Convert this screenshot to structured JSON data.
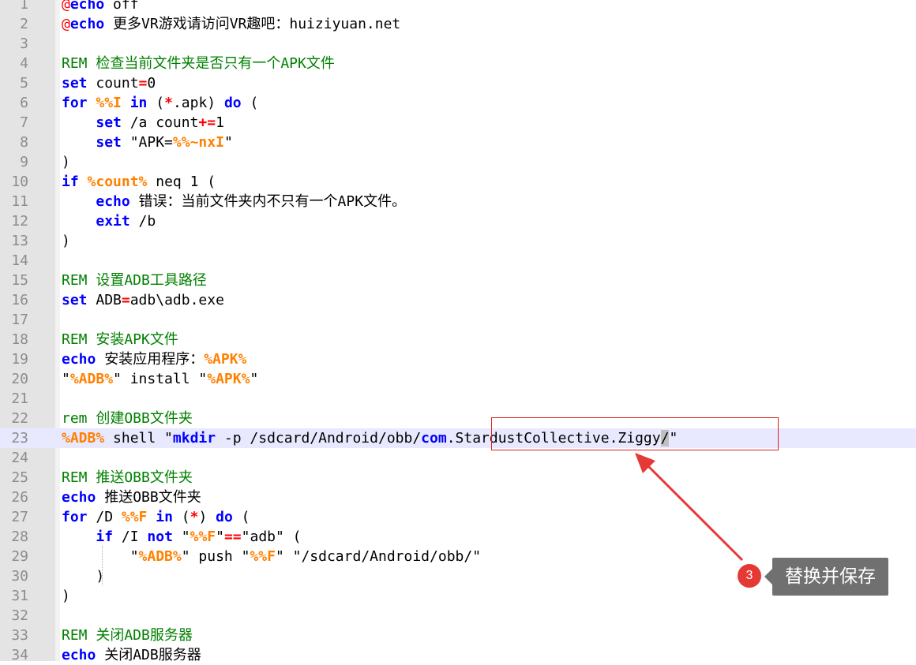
{
  "editor": {
    "lines": [
      {
        "num": "1",
        "tokens": [
          {
            "t": "at",
            "v": "@"
          },
          {
            "t": "kw",
            "v": "echo"
          },
          {
            "t": "tx",
            "v": " off"
          }
        ]
      },
      {
        "num": "2",
        "tokens": [
          {
            "t": "at",
            "v": "@"
          },
          {
            "t": "kw",
            "v": "echo"
          },
          {
            "t": "tx",
            "v": " 更多VR游戏请访问VR趣吧：huiziyuan.net"
          }
        ]
      },
      {
        "num": "3",
        "tokens": []
      },
      {
        "num": "4",
        "tokens": [
          {
            "t": "cm",
            "v": "REM 检查当前文件夹是否只有一个APK文件"
          }
        ]
      },
      {
        "num": "5",
        "tokens": [
          {
            "t": "kw",
            "v": "set"
          },
          {
            "t": "tx",
            "v": " count"
          },
          {
            "t": "op",
            "v": "="
          },
          {
            "t": "tx",
            "v": "0"
          }
        ]
      },
      {
        "num": "6",
        "tokens": [
          {
            "t": "kw",
            "v": "for"
          },
          {
            "t": "tx",
            "v": " "
          },
          {
            "t": "var",
            "v": "%%I"
          },
          {
            "t": "tx",
            "v": " "
          },
          {
            "t": "kw",
            "v": "in"
          },
          {
            "t": "tx",
            "v": " ("
          },
          {
            "t": "op",
            "v": "*"
          },
          {
            "t": "tx",
            "v": ".apk) "
          },
          {
            "t": "kw",
            "v": "do"
          },
          {
            "t": "tx",
            "v": " ("
          }
        ]
      },
      {
        "num": "7",
        "tokens": [
          {
            "t": "tx",
            "v": "    "
          },
          {
            "t": "kw",
            "v": "set"
          },
          {
            "t": "tx",
            "v": " /a count"
          },
          {
            "t": "op",
            "v": "+="
          },
          {
            "t": "tx",
            "v": "1"
          }
        ]
      },
      {
        "num": "8",
        "tokens": [
          {
            "t": "tx",
            "v": "    "
          },
          {
            "t": "kw",
            "v": "set"
          },
          {
            "t": "tx",
            "v": " \"APK="
          },
          {
            "t": "var",
            "v": "%%~nxI"
          },
          {
            "t": "tx",
            "v": "\""
          }
        ]
      },
      {
        "num": "9",
        "tokens": [
          {
            "t": "tx",
            "v": ")"
          }
        ]
      },
      {
        "num": "10",
        "tokens": [
          {
            "t": "kw",
            "v": "if"
          },
          {
            "t": "tx",
            "v": " "
          },
          {
            "t": "var",
            "v": "%count%"
          },
          {
            "t": "tx",
            "v": " neq 1 ("
          }
        ]
      },
      {
        "num": "11",
        "tokens": [
          {
            "t": "tx",
            "v": "    "
          },
          {
            "t": "kw",
            "v": "echo"
          },
          {
            "t": "tx",
            "v": " 错误：当前文件夹内不只有一个APK文件。"
          }
        ]
      },
      {
        "num": "12",
        "tokens": [
          {
            "t": "tx",
            "v": "    "
          },
          {
            "t": "kw",
            "v": "exit"
          },
          {
            "t": "tx",
            "v": " /b"
          }
        ]
      },
      {
        "num": "13",
        "tokens": [
          {
            "t": "tx",
            "v": ")"
          }
        ]
      },
      {
        "num": "14",
        "tokens": []
      },
      {
        "num": "15",
        "tokens": [
          {
            "t": "cm",
            "v": "REM 设置ADB工具路径"
          }
        ]
      },
      {
        "num": "16",
        "tokens": [
          {
            "t": "kw",
            "v": "set"
          },
          {
            "t": "tx",
            "v": " ADB"
          },
          {
            "t": "op",
            "v": "="
          },
          {
            "t": "tx",
            "v": "adb\\adb.exe"
          }
        ]
      },
      {
        "num": "17",
        "tokens": []
      },
      {
        "num": "18",
        "tokens": [
          {
            "t": "cm",
            "v": "REM 安装APK文件"
          }
        ]
      },
      {
        "num": "19",
        "tokens": [
          {
            "t": "kw",
            "v": "echo"
          },
          {
            "t": "tx",
            "v": " 安装应用程序："
          },
          {
            "t": "var",
            "v": "%APK%"
          }
        ]
      },
      {
        "num": "20",
        "tokens": [
          {
            "t": "tx",
            "v": "\""
          },
          {
            "t": "var",
            "v": "%ADB%"
          },
          {
            "t": "tx",
            "v": "\" install \""
          },
          {
            "t": "var",
            "v": "%APK%"
          },
          {
            "t": "tx",
            "v": "\""
          }
        ]
      },
      {
        "num": "21",
        "tokens": []
      },
      {
        "num": "22",
        "tokens": [
          {
            "t": "cm",
            "v": "rem 创建OBB文件夹"
          }
        ]
      },
      {
        "num": "23",
        "current": true,
        "tokens": [
          {
            "t": "var",
            "v": "%ADB%"
          },
          {
            "t": "tx",
            "v": " shell \""
          },
          {
            "t": "kw",
            "v": "mkdir"
          },
          {
            "t": "tx",
            "v": " -p /sdcard/Android/obb/"
          },
          {
            "t": "kw",
            "v": "com"
          },
          {
            "t": "tx",
            "v": ".StardustCollective.Ziggy"
          },
          {
            "t": "caret",
            "v": "/"
          },
          {
            "t": "tx",
            "v": "\""
          }
        ]
      },
      {
        "num": "24",
        "tokens": []
      },
      {
        "num": "25",
        "tokens": [
          {
            "t": "cm",
            "v": "REM 推送OBB文件夹"
          }
        ]
      },
      {
        "num": "26",
        "tokens": [
          {
            "t": "kw",
            "v": "echo"
          },
          {
            "t": "tx",
            "v": " 推送OBB文件夹"
          }
        ]
      },
      {
        "num": "27",
        "tokens": [
          {
            "t": "kw",
            "v": "for"
          },
          {
            "t": "tx",
            "v": " /D "
          },
          {
            "t": "var",
            "v": "%%F"
          },
          {
            "t": "tx",
            "v": " "
          },
          {
            "t": "kw",
            "v": "in"
          },
          {
            "t": "tx",
            "v": " ("
          },
          {
            "t": "op",
            "v": "*"
          },
          {
            "t": "tx",
            "v": ") "
          },
          {
            "t": "kw",
            "v": "do"
          },
          {
            "t": "tx",
            "v": " ("
          }
        ]
      },
      {
        "num": "28",
        "tokens": [
          {
            "t": "tx",
            "v": "    "
          },
          {
            "t": "kw",
            "v": "if"
          },
          {
            "t": "tx",
            "v": " /I "
          },
          {
            "t": "kw",
            "v": "not"
          },
          {
            "t": "tx",
            "v": " \""
          },
          {
            "t": "var",
            "v": "%%F"
          },
          {
            "t": "tx",
            "v": "\""
          },
          {
            "t": "op",
            "v": "=="
          },
          {
            "t": "tx",
            "v": "\"adb\" ("
          }
        ]
      },
      {
        "num": "29",
        "tokens": [
          {
            "t": "tx",
            "v": "        \""
          },
          {
            "t": "var",
            "v": "%ADB%"
          },
          {
            "t": "tx",
            "v": "\" push \""
          },
          {
            "t": "var",
            "v": "%%F"
          },
          {
            "t": "tx",
            "v": "\" \"/sdcard/Android/obb/\""
          }
        ]
      },
      {
        "num": "30",
        "tokens": [
          {
            "t": "tx",
            "v": "    )"
          }
        ]
      },
      {
        "num": "31",
        "tokens": [
          {
            "t": "tx",
            "v": ")"
          }
        ]
      },
      {
        "num": "32",
        "tokens": []
      },
      {
        "num": "33",
        "tokens": [
          {
            "t": "cm",
            "v": "REM 关闭ADB服务器"
          }
        ]
      },
      {
        "num": "34",
        "tokens": [
          {
            "t": "kw",
            "v": "echo"
          },
          {
            "t": "tx",
            "v": " 关闭ADB服务器"
          }
        ]
      }
    ]
  },
  "annotation": {
    "step_number": "3",
    "tooltip_text": "替换并保存",
    "color": "#e53935"
  }
}
